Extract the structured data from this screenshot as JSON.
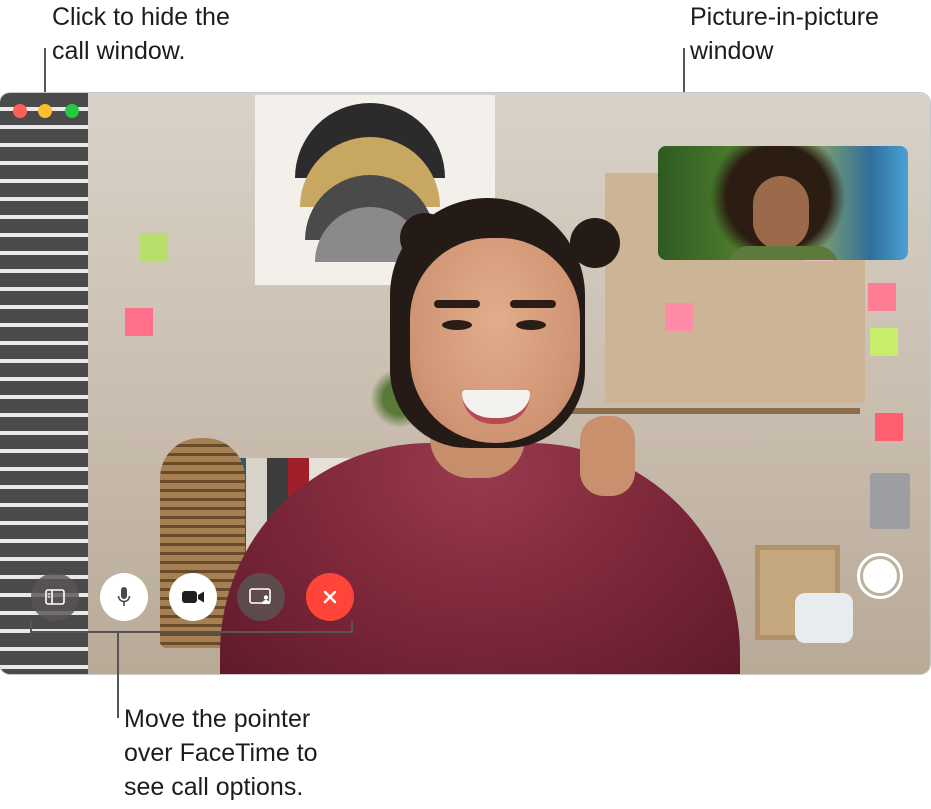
{
  "callouts": {
    "hide_call_window": {
      "line1": "Click to hide the",
      "line2": "call window."
    },
    "pip_window": {
      "line1": "Picture-in-picture",
      "line2": "window"
    },
    "call_options": {
      "line1": "Move the pointer",
      "line2": "over FaceTime to",
      "line3": "see call options."
    }
  },
  "window": {
    "controls": [
      "close",
      "minimize",
      "full-screen"
    ]
  },
  "call_controls": [
    {
      "name": "sidebar-button",
      "icon": "sidebar-icon"
    },
    {
      "name": "mute-button",
      "icon": "microphone-icon"
    },
    {
      "name": "camera-button",
      "icon": "video-camera-icon"
    },
    {
      "name": "share-screen-button",
      "icon": "screen-share-icon"
    },
    {
      "name": "end-call-button",
      "icon": "close-icon"
    }
  ],
  "capture_button": {
    "icon": "shutter-icon"
  },
  "colors": {
    "traffic_close": "#ff5f57",
    "traffic_minimize": "#febc2e",
    "traffic_maximize": "#28c840",
    "end_call": "#ff453a",
    "control_dark": "#5a5454"
  }
}
